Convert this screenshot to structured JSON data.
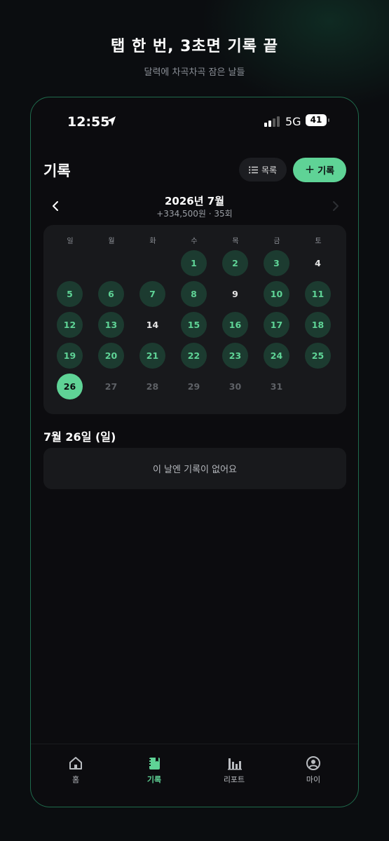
{
  "promo": {
    "title": "탭 한 번, 3초면 기록 끝",
    "subtitle": "달력에 차곡차곡 잠은 날들"
  },
  "status_bar": {
    "time": "12:55",
    "network": "5G",
    "battery": "41"
  },
  "header": {
    "title": "기록",
    "list_button": "목록",
    "add_button": "기록"
  },
  "month_nav": {
    "label": "2026년 7월",
    "summary": "+334,500원 · 35회"
  },
  "calendar": {
    "weekdays": [
      "일",
      "월",
      "화",
      "수",
      "목",
      "금",
      "토"
    ],
    "first_weekday_index": 3,
    "days": [
      {
        "n": "1",
        "state": "rec"
      },
      {
        "n": "2",
        "state": "rec"
      },
      {
        "n": "3",
        "state": "rec"
      },
      {
        "n": "4",
        "state": "plain"
      },
      {
        "n": "5",
        "state": "rec"
      },
      {
        "n": "6",
        "state": "rec"
      },
      {
        "n": "7",
        "state": "rec"
      },
      {
        "n": "8",
        "state": "rec"
      },
      {
        "n": "9",
        "state": "plain"
      },
      {
        "n": "10",
        "state": "rec"
      },
      {
        "n": "11",
        "state": "rec"
      },
      {
        "n": "12",
        "state": "rec"
      },
      {
        "n": "13",
        "state": "rec"
      },
      {
        "n": "14",
        "state": "plain"
      },
      {
        "n": "15",
        "state": "rec"
      },
      {
        "n": "16",
        "state": "rec"
      },
      {
        "n": "17",
        "state": "rec"
      },
      {
        "n": "18",
        "state": "rec"
      },
      {
        "n": "19",
        "state": "rec"
      },
      {
        "n": "20",
        "state": "rec"
      },
      {
        "n": "21",
        "state": "rec"
      },
      {
        "n": "22",
        "state": "rec"
      },
      {
        "n": "23",
        "state": "rec"
      },
      {
        "n": "24",
        "state": "rec"
      },
      {
        "n": "25",
        "state": "rec"
      },
      {
        "n": "26",
        "state": "selected"
      },
      {
        "n": "27",
        "state": "future"
      },
      {
        "n": "28",
        "state": "future"
      },
      {
        "n": "29",
        "state": "future"
      },
      {
        "n": "30",
        "state": "future"
      },
      {
        "n": "31",
        "state": "future"
      }
    ]
  },
  "selected_date": {
    "label": "7월 26일 (일)",
    "empty_message": "이 날엔 기록이 없어요"
  },
  "tabs": [
    {
      "label": "홈",
      "icon": "home-icon",
      "active": false
    },
    {
      "label": "기록",
      "icon": "notebook-icon",
      "active": true
    },
    {
      "label": "리포트",
      "icon": "bar-chart-icon",
      "active": false
    },
    {
      "label": "마이",
      "icon": "profile-icon",
      "active": false
    }
  ],
  "colors": {
    "accent": "#5fd396",
    "recorded_day_bg": "#1c3b30",
    "background": "#0c0c0f",
    "card": "#18191c"
  }
}
